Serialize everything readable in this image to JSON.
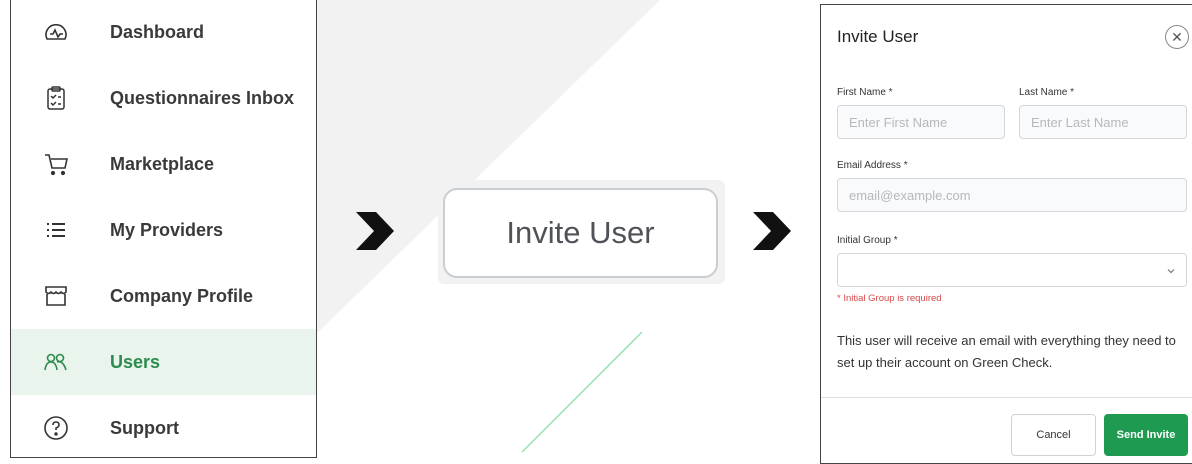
{
  "sidebar": {
    "items": [
      {
        "label": "Dashboard",
        "icon": "dashboard-icon",
        "active": false
      },
      {
        "label": "Questionnaires Inbox",
        "icon": "clipboard-checklist-icon",
        "active": false
      },
      {
        "label": "Marketplace",
        "icon": "cart-icon",
        "active": false
      },
      {
        "label": "My Providers",
        "icon": "list-icon",
        "active": false
      },
      {
        "label": "Company Profile",
        "icon": "storefront-icon",
        "active": false
      },
      {
        "label": "Users",
        "icon": "users-icon",
        "active": true
      },
      {
        "label": "Support",
        "icon": "help-icon",
        "active": false
      }
    ]
  },
  "invite_button": {
    "label": "Invite User"
  },
  "modal": {
    "title": "Invite User",
    "close_icon": "close-icon",
    "first_name": {
      "label": "First Name *",
      "placeholder": "Enter First Name"
    },
    "last_name": {
      "label": "Last Name *",
      "placeholder": "Enter Last Name"
    },
    "email": {
      "label": "Email Address *",
      "placeholder": "email@example.com"
    },
    "group": {
      "label": "Initial Group *",
      "value": "",
      "error": "* Initial Group is required"
    },
    "note": "This user will receive an email with everything they need to set up their account on Green Check.",
    "cancel_label": "Cancel",
    "send_label": "Send Invite"
  },
  "colors": {
    "accent": "#1e9a51",
    "active_bg": "#e9f4ec",
    "active_text": "#2e8b4e",
    "error": "#d94848"
  }
}
